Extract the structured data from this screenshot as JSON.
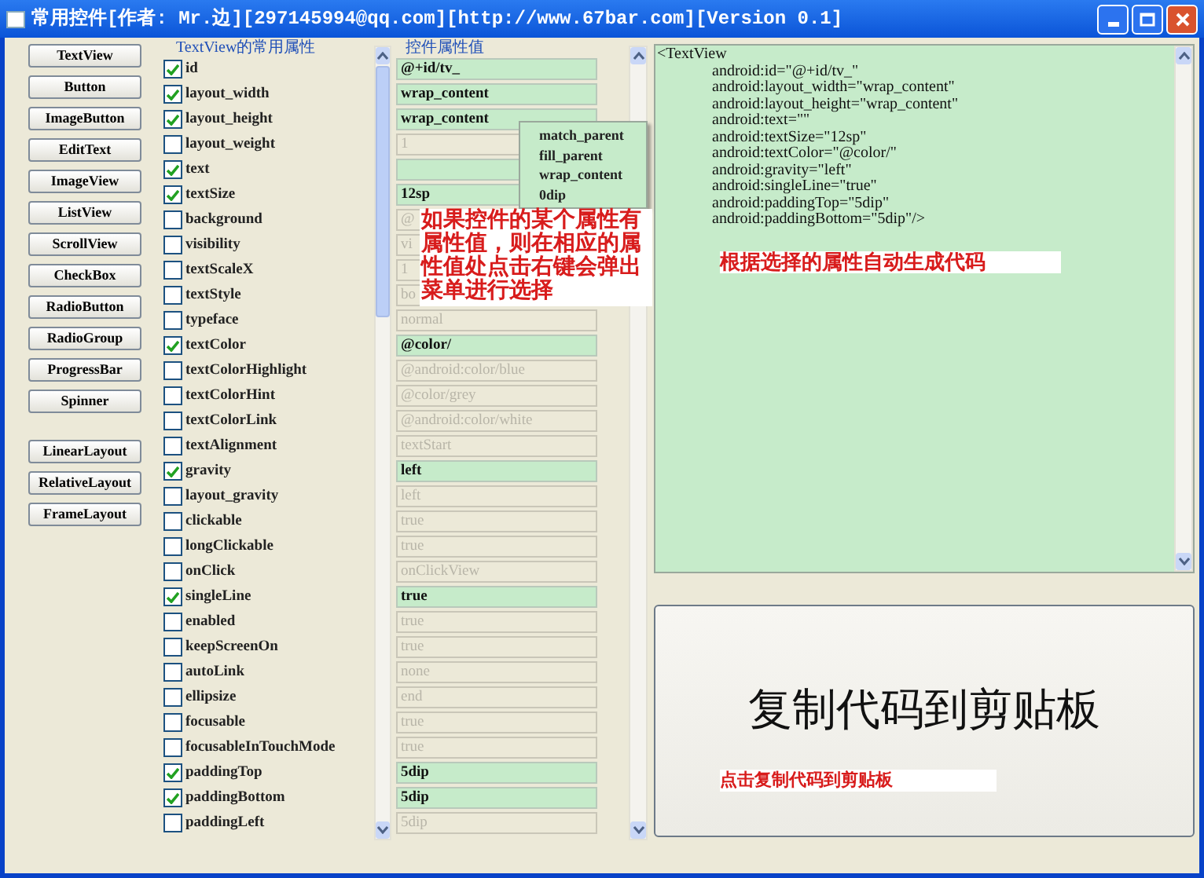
{
  "window": {
    "title": "常用控件[作者: Mr.边][297145994@qq.com][http://www.67bar.com][Version 0.1]"
  },
  "widget_groups": [
    {
      "buttons": [
        "TextView",
        "Button",
        "ImageButton",
        "EditText",
        "ImageView",
        "ListView",
        "ScrollView",
        "CheckBox",
        "RadioButton",
        "RadioGroup",
        "ProgressBar",
        "Spinner"
      ]
    },
    {
      "buttons": [
        "LinearLayout",
        "RelativeLayout",
        "FrameLayout"
      ]
    }
  ],
  "properties": {
    "title": "TextView的常用属性",
    "value_title": "控件属性值",
    "rows": [
      {
        "name": "id",
        "checked": true,
        "value": "@+id/tv_"
      },
      {
        "name": "layout_width",
        "checked": true,
        "value": "wrap_content"
      },
      {
        "name": "layout_height",
        "checked": true,
        "value": "wrap_content"
      },
      {
        "name": "layout_weight",
        "checked": false,
        "value": "1"
      },
      {
        "name": "text",
        "checked": true
      },
      {
        "name": "textSize",
        "checked": true,
        "value": "12sp"
      },
      {
        "name": "background",
        "checked": false,
        "value": "@"
      },
      {
        "name": "visibility",
        "checked": false,
        "value": "vi"
      },
      {
        "name": "textScaleX",
        "checked": false,
        "value": "1"
      },
      {
        "name": "textStyle",
        "checked": false,
        "value": "bo"
      },
      {
        "name": "typeface",
        "checked": false,
        "value": "normal"
      },
      {
        "name": "textColor",
        "checked": true,
        "value": "@color/"
      },
      {
        "name": "textColorHighlight",
        "checked": false,
        "value": "@android:color/blue"
      },
      {
        "name": "textColorHint",
        "checked": false,
        "value": "@color/grey"
      },
      {
        "name": "textColorLink",
        "checked": false,
        "value": "@android:color/white"
      },
      {
        "name": "textAlignment",
        "checked": false,
        "value": "textStart"
      },
      {
        "name": "gravity",
        "checked": true,
        "value": "left"
      },
      {
        "name": "layout_gravity",
        "checked": false,
        "value": "left"
      },
      {
        "name": "clickable",
        "checked": false,
        "value": "true"
      },
      {
        "name": "longClickable",
        "checked": false,
        "value": "true"
      },
      {
        "name": "onClick",
        "checked": false,
        "value": "onClickView"
      },
      {
        "name": "singleLine",
        "checked": true,
        "value": "true"
      },
      {
        "name": "enabled",
        "checked": false,
        "value": "true"
      },
      {
        "name": "keepScreenOn",
        "checked": false,
        "value": "true"
      },
      {
        "name": "autoLink",
        "checked": false,
        "value": "none"
      },
      {
        "name": "ellipsize",
        "checked": false,
        "value": "end"
      },
      {
        "name": "focusable",
        "checked": false,
        "value": "true"
      },
      {
        "name": "focusableInTouchMode",
        "checked": false,
        "value": "true"
      },
      {
        "name": "paddingTop",
        "checked": true,
        "value": "5dip"
      },
      {
        "name": "paddingBottom",
        "checked": true,
        "value": "5dip"
      },
      {
        "name": "paddingLeft",
        "checked": false,
        "value": "5dip"
      }
    ]
  },
  "context_menu": {
    "items": [
      "match_parent",
      "fill_parent",
      "wrap_content",
      "0dip"
    ]
  },
  "hint_overlay": "如果控件的某个属性有属性值，则在相应的属性值处点击右键会弹出菜单进行选择",
  "code": {
    "lines": [
      "<TextView",
      "android:id=\"@+id/tv_\"",
      "android:layout_width=\"wrap_content\"",
      "android:layout_height=\"wrap_content\"",
      "android:text=\"\"",
      "android:textSize=\"12sp\"",
      "android:textColor=\"@color/\"",
      "android:gravity=\"left\"",
      "android:singleLine=\"true\"",
      "android:paddingTop=\"5dip\"",
      "android:paddingBottom=\"5dip\"/>"
    ],
    "hint": "根据选择的属性自动生成代码"
  },
  "copy_button": {
    "label": "复制代码到剪贴板",
    "hint": "点击复制代码到剪贴板"
  }
}
